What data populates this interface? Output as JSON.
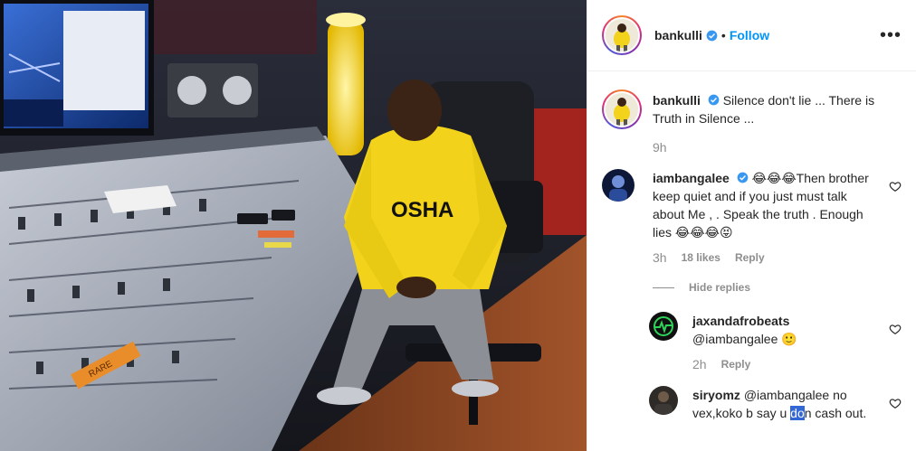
{
  "post": {
    "author": "bankulli",
    "follow_label": "Follow",
    "dot": "•",
    "more_icon": "more-horizontal-icon"
  },
  "caption": {
    "username": "bankulli",
    "text": "Silence don't lie ... There is Truth in Silence ...",
    "time": "9h"
  },
  "comments": [
    {
      "username": "iambangalee",
      "text": "😂😂😂Then brother keep quiet and if you just must talk about Me , . Speak the truth . Enough lies 😂😂😂😝",
      "time": "3h",
      "likes": "18 likes",
      "reply_label": "Reply",
      "hide_replies": "Hide replies",
      "replies": [
        {
          "username": "jaxandafrobeats",
          "text": "@iambangalee 🙂",
          "time": "2h",
          "reply_label": "Reply"
        },
        {
          "username": "siryomz",
          "text_before": "@iambangalee no vex,koko b say u ",
          "text_selected": "do",
          "text_after": "n cash out."
        }
      ]
    }
  ],
  "photo": {
    "hoodie_text": "OSHA",
    "snack_text": "RARE"
  },
  "colors": {
    "link": "#0095f6",
    "muted": "#8e8e8e",
    "text": "#262626",
    "hoodie": "#f2d21a"
  }
}
